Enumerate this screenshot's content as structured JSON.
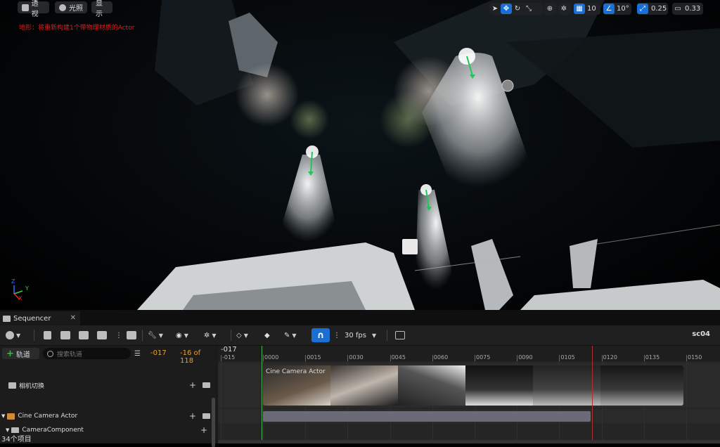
{
  "viewport": {
    "buttons": [
      {
        "label": "透视",
        "icon": "cube-icon"
      },
      {
        "label": "光照",
        "icon": "sun-icon"
      },
      {
        "label": "显示",
        "icon": ""
      }
    ],
    "warning": "地形：将重新构建1个带物理材质的Actor",
    "grid_snap": "10",
    "rotation_snap": "10°",
    "scale_snap": "0.25",
    "camera_speed": "0.33",
    "axis": {
      "x": "X",
      "y": "Y",
      "z": "Z"
    }
  },
  "sequencer": {
    "tab_label": "Sequencer",
    "fps_label": "30 fps",
    "sequence_name": "sc04",
    "add_track_label": "轨道",
    "search_placeholder": "搜索轨道",
    "current_frame": "-017",
    "frame_counter": "-16 of 118",
    "ruler_current": "-017",
    "ticks": [
      "-015",
      "0000",
      "0015",
      "0030",
      "0045",
      "0060",
      "0075",
      "0090",
      "0105",
      "0120",
      "0135",
      "0150"
    ],
    "tracks": [
      {
        "label": "相机切换"
      },
      {
        "label": "Cine Camera Actor"
      },
      {
        "label": "CameraComponent"
      }
    ],
    "cut_label": "Cine Camera Actor",
    "status": "34个项目"
  }
}
